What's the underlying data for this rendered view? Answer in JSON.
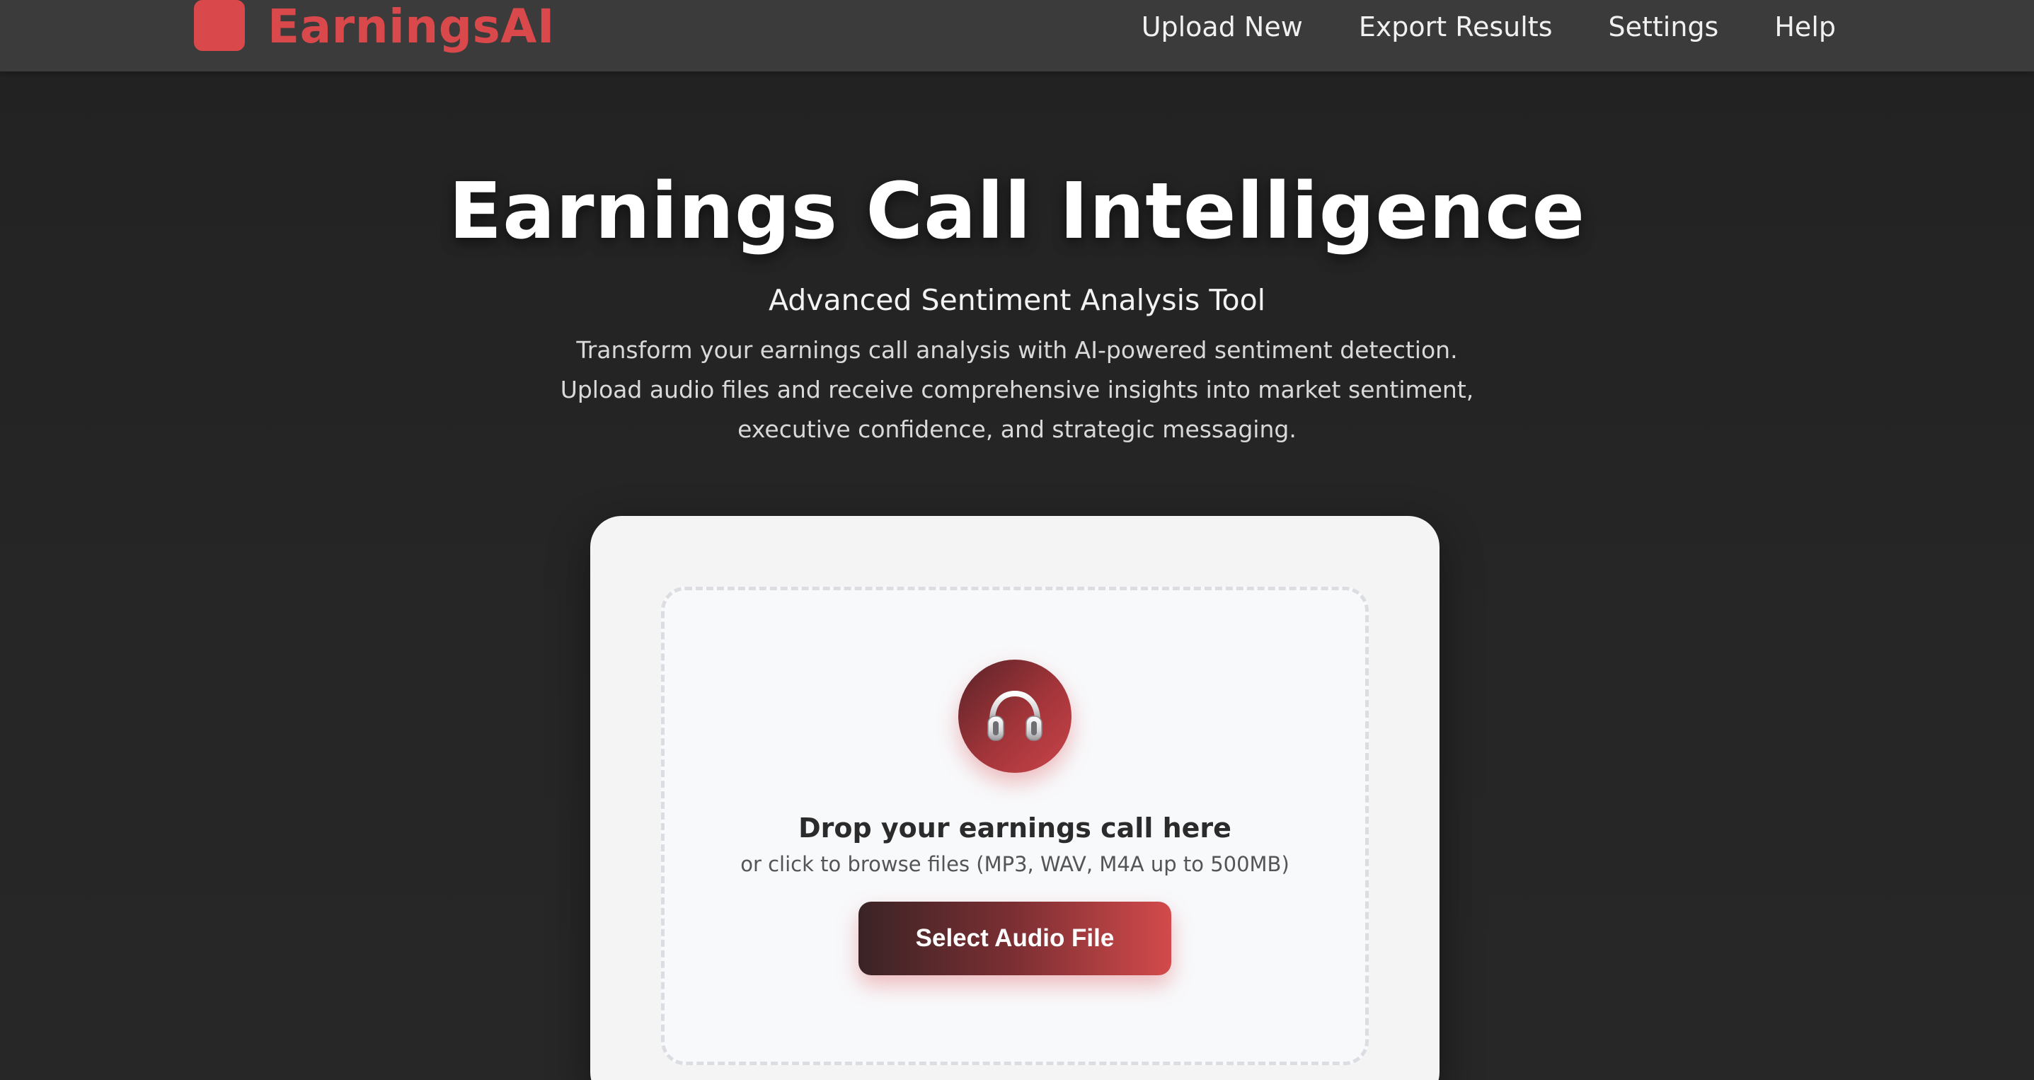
{
  "brand": {
    "name": "EarningsAI",
    "accent_color": "#d9484a",
    "logo_icon": "logo-square-icon"
  },
  "nav": {
    "items": [
      {
        "label": "Upload New"
      },
      {
        "label": "Export Results"
      },
      {
        "label": "Settings"
      },
      {
        "label": "Help"
      }
    ]
  },
  "hero": {
    "title": "Earnings Call Intelligence",
    "subtitle": "Advanced Sentiment Analysis Tool",
    "description": "Transform your earnings call analysis with AI-powered sentiment detection. Upload audio files and receive comprehensive insights into market sentiment, executive confidence, and strategic messaging."
  },
  "upload": {
    "icon": "headphones-icon",
    "title": "Drop your earnings call here",
    "hint": "or click to browse files (MP3, WAV, M4A up to 500MB)",
    "button_label": "Select Audio File"
  }
}
